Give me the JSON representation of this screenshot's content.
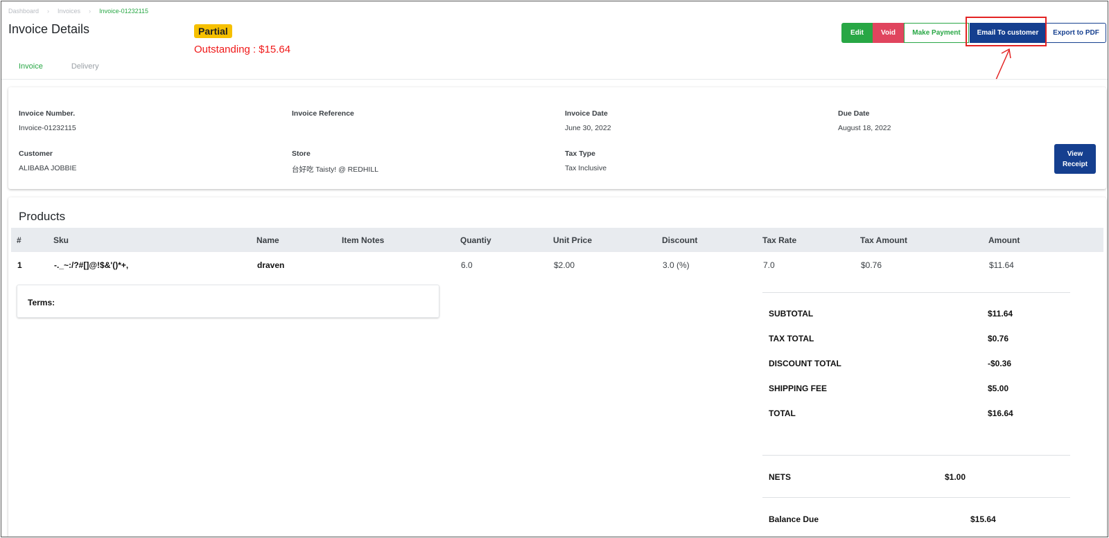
{
  "breadcrumb": {
    "items": [
      "Dashboard",
      "Invoices",
      "Invoice-01232115"
    ]
  },
  "page": {
    "title": "Invoice Details"
  },
  "status": {
    "badge": "Partial",
    "outstanding_label": "Outstanding :",
    "outstanding_amount": "$15.64"
  },
  "toolbar": {
    "edit": "Edit",
    "void": "Void",
    "make_payment": "Make Payment",
    "email": "Email To customer",
    "export_pdf": "Export to PDF"
  },
  "tabs": [
    {
      "label": "Invoice",
      "active": true
    },
    {
      "label": "Delivery",
      "active": false
    }
  ],
  "info": {
    "invoice_number_label": "Invoice Number.",
    "invoice_number": "Invoice-01232115",
    "invoice_reference_label": "Invoice Reference",
    "invoice_reference": "",
    "invoice_date_label": "Invoice Date",
    "invoice_date": "June 30, 2022",
    "due_date_label": "Due Date",
    "due_date": "August 18, 2022",
    "customer_label": "Customer",
    "customer": "ALIBABA JOBBIE",
    "store_label": "Store",
    "store": "台好吃 Taisty! @ REDHILL",
    "tax_type_label": "Tax Type",
    "tax_type": "Tax Inclusive",
    "view_receipt_line1": "View",
    "view_receipt_line2": "Receipt"
  },
  "products": {
    "title": "Products",
    "columns": [
      "#",
      "Sku",
      "Name",
      "Item Notes",
      "Quantiy",
      "Unit Price",
      "Discount",
      "Tax Rate",
      "Tax Amount",
      "Amount"
    ],
    "rows": [
      {
        "num": "1",
        "sku": "-._~:/?#[]@!$&'()*+,",
        "name": "draven",
        "notes": "",
        "quantity": "6.0",
        "unit_price": "$2.00",
        "discount": "3.0 (%)",
        "tax_rate": "7.0",
        "tax_amount": "$0.76",
        "amount": "$11.64"
      }
    ]
  },
  "terms": {
    "label": "Terms:"
  },
  "totals": {
    "subtotal_label": "SUBTOTAL",
    "subtotal": "$11.64",
    "tax_total_label": "TAX TOTAL",
    "tax_total": "$0.76",
    "discount_total_label": "DISCOUNT TOTAL",
    "discount_total": "-$0.36",
    "shipping_label": "SHIPPING FEE",
    "shipping": "$5.00",
    "total_label": "TOTAL",
    "total": "$16.64",
    "nets_label": "NETS",
    "nets": "$1.00",
    "balance_label": "Balance Due",
    "balance": "$15.64"
  },
  "colors": {
    "green": "#28a745",
    "red": "#e0455e",
    "navy": "#153f8f",
    "badge_yellow": "#f6c000",
    "outstanding_red": "#f01818",
    "annotation_red": "#e32323"
  }
}
